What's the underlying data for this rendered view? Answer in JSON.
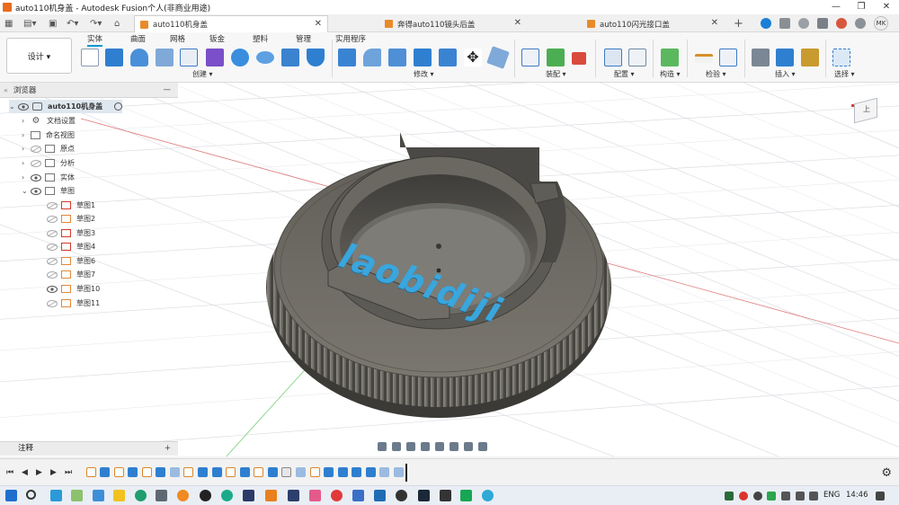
{
  "window": {
    "title": "auto110机身盖 - Autodesk Fusion个人(非商业用途)",
    "controls": [
      "—",
      "❐",
      "✕"
    ]
  },
  "tabs": [
    {
      "label": "auto110机身盖",
      "active": true,
      "close": "✕"
    },
    {
      "label": "奔得auto110镜头后盖",
      "active": false,
      "close": "✕"
    },
    {
      "label": "auto110闪光接口盖",
      "active": false,
      "close": "✕"
    }
  ],
  "user": {
    "initials": "MK"
  },
  "toolbar": {
    "workspace": "设计 ▾",
    "tabs": [
      "实体",
      "曲面",
      "网格",
      "钣金",
      "塑料",
      "管理",
      "实用程序"
    ],
    "groups": [
      "创建 ▾",
      "修改 ▾",
      "装配 ▾",
      "配置 ▾",
      "构造 ▾",
      "检验 ▾",
      "插入 ▾",
      "选择 ▾"
    ]
  },
  "browser": {
    "header": "浏览器",
    "collapse": "«",
    "minimize": "—",
    "items": [
      {
        "label": "auto110机身盖"
      },
      {
        "label": "文档设置"
      },
      {
        "label": "命名视图"
      },
      {
        "label": "原点"
      },
      {
        "label": "分析"
      },
      {
        "label": "实体"
      },
      {
        "label": "草图"
      },
      {
        "label": "草图1"
      },
      {
        "label": "草图2"
      },
      {
        "label": "草图3"
      },
      {
        "label": "草图4"
      },
      {
        "label": "草图6"
      },
      {
        "label": "草图7"
      },
      {
        "label": "草图10"
      },
      {
        "label": "草图11"
      }
    ]
  },
  "comments": {
    "label": "注释",
    "add": "+"
  },
  "model": {
    "engraved_text": "laobidiji"
  },
  "viewcube": {
    "face": "上"
  },
  "timeline": {
    "play_controls": [
      "⏮",
      "◀",
      "▶",
      "▶",
      "⏭"
    ],
    "gear": "⚙"
  },
  "taskbar": {
    "language": "ENG",
    "time": "14:46"
  },
  "colors": {
    "accent": "#0696d7",
    "model_gray": "#6e6c66",
    "engraved_text": "#39a6de",
    "sketch_icon_red": "#d23b2b"
  }
}
